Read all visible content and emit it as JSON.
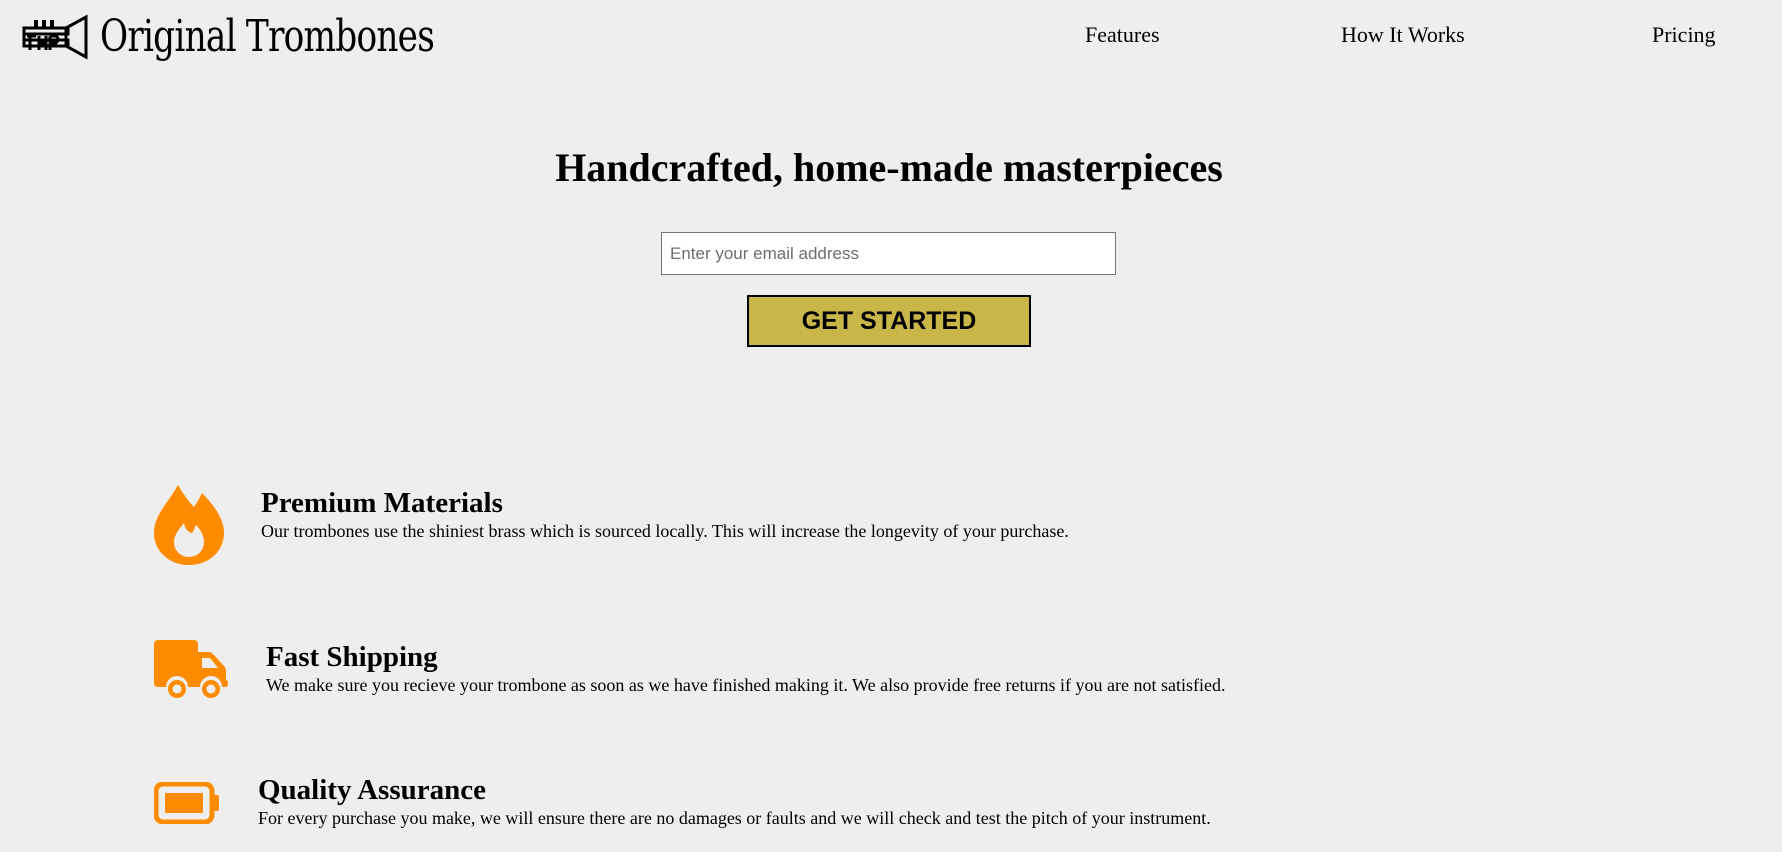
{
  "brand": {
    "name": "Original Trombones",
    "logo_icon": "trombone-logo-icon"
  },
  "nav": {
    "items": [
      {
        "label": "Features"
      },
      {
        "label": "How It Works"
      },
      {
        "label": "Pricing"
      }
    ]
  },
  "hero": {
    "title": "Handcrafted, home-made masterpieces",
    "email_placeholder": "Enter your email address",
    "email_value": "",
    "cta_label": "GET STARTED"
  },
  "colors": {
    "background": "#eeeeee",
    "accent_button": "#c9b649",
    "feature_icon": "#ff8c00"
  },
  "features": [
    {
      "icon": "fire-icon",
      "title": "Premium Materials",
      "description": "Our trombones use the shiniest brass which is sourced locally. This will increase the longevity of your purchase."
    },
    {
      "icon": "truck-icon",
      "title": "Fast Shipping",
      "description": "We make sure you recieve your trombone as soon as we have finished making it. We also provide free returns if you are not satisfied."
    },
    {
      "icon": "battery-icon",
      "title": "Quality Assurance",
      "description": "For every purchase you make, we will ensure there are no damages or faults and we will check and test the pitch of your instrument."
    }
  ]
}
